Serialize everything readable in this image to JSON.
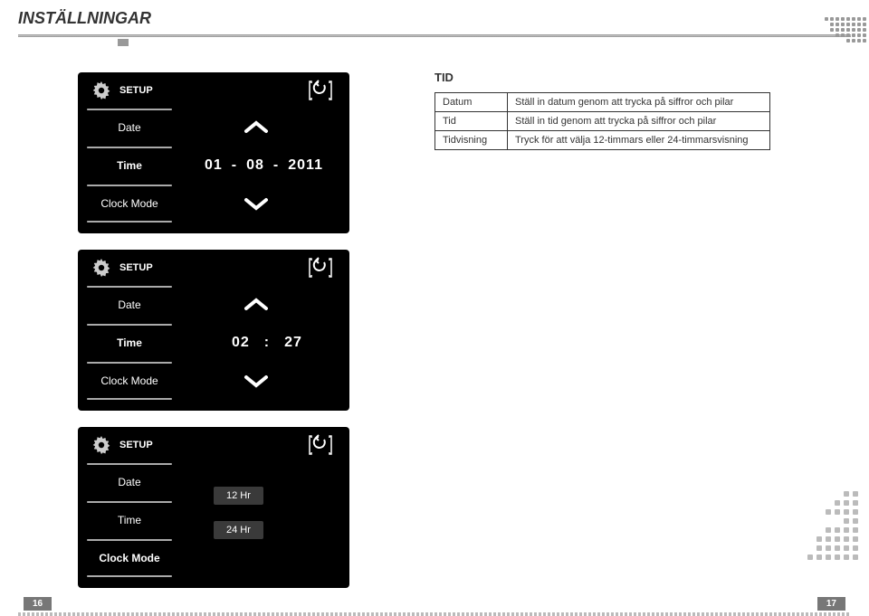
{
  "header": {
    "title": "INSTÄLLNINGAR"
  },
  "tid": {
    "title": "TID",
    "rows": [
      {
        "label": "Datum",
        "desc": "Ställ in datum genom att trycka på siffror och pilar"
      },
      {
        "label": "Tid",
        "desc": "Ställ in tid genom att trycka på siffror och pilar"
      },
      {
        "label": "Tidvisning",
        "desc": "Tryck för att välja 12-timmars eller 24-timmarsvisning"
      }
    ]
  },
  "setup_label": "SETUP",
  "menu": {
    "date": "Date",
    "time": "Time",
    "clock_mode": "Clock Mode"
  },
  "panel1": {
    "active": "time",
    "date": {
      "d": "01",
      "m": "08",
      "y": "2011",
      "sep": "-"
    }
  },
  "panel2": {
    "active": "time",
    "time": {
      "h": "02",
      "m": "27",
      "sep": ":"
    }
  },
  "panel3": {
    "active": "clock_mode",
    "options": {
      "hr12": "12 Hr",
      "hr24": "24 Hr"
    }
  },
  "pages": {
    "left": "16",
    "right": "17"
  }
}
